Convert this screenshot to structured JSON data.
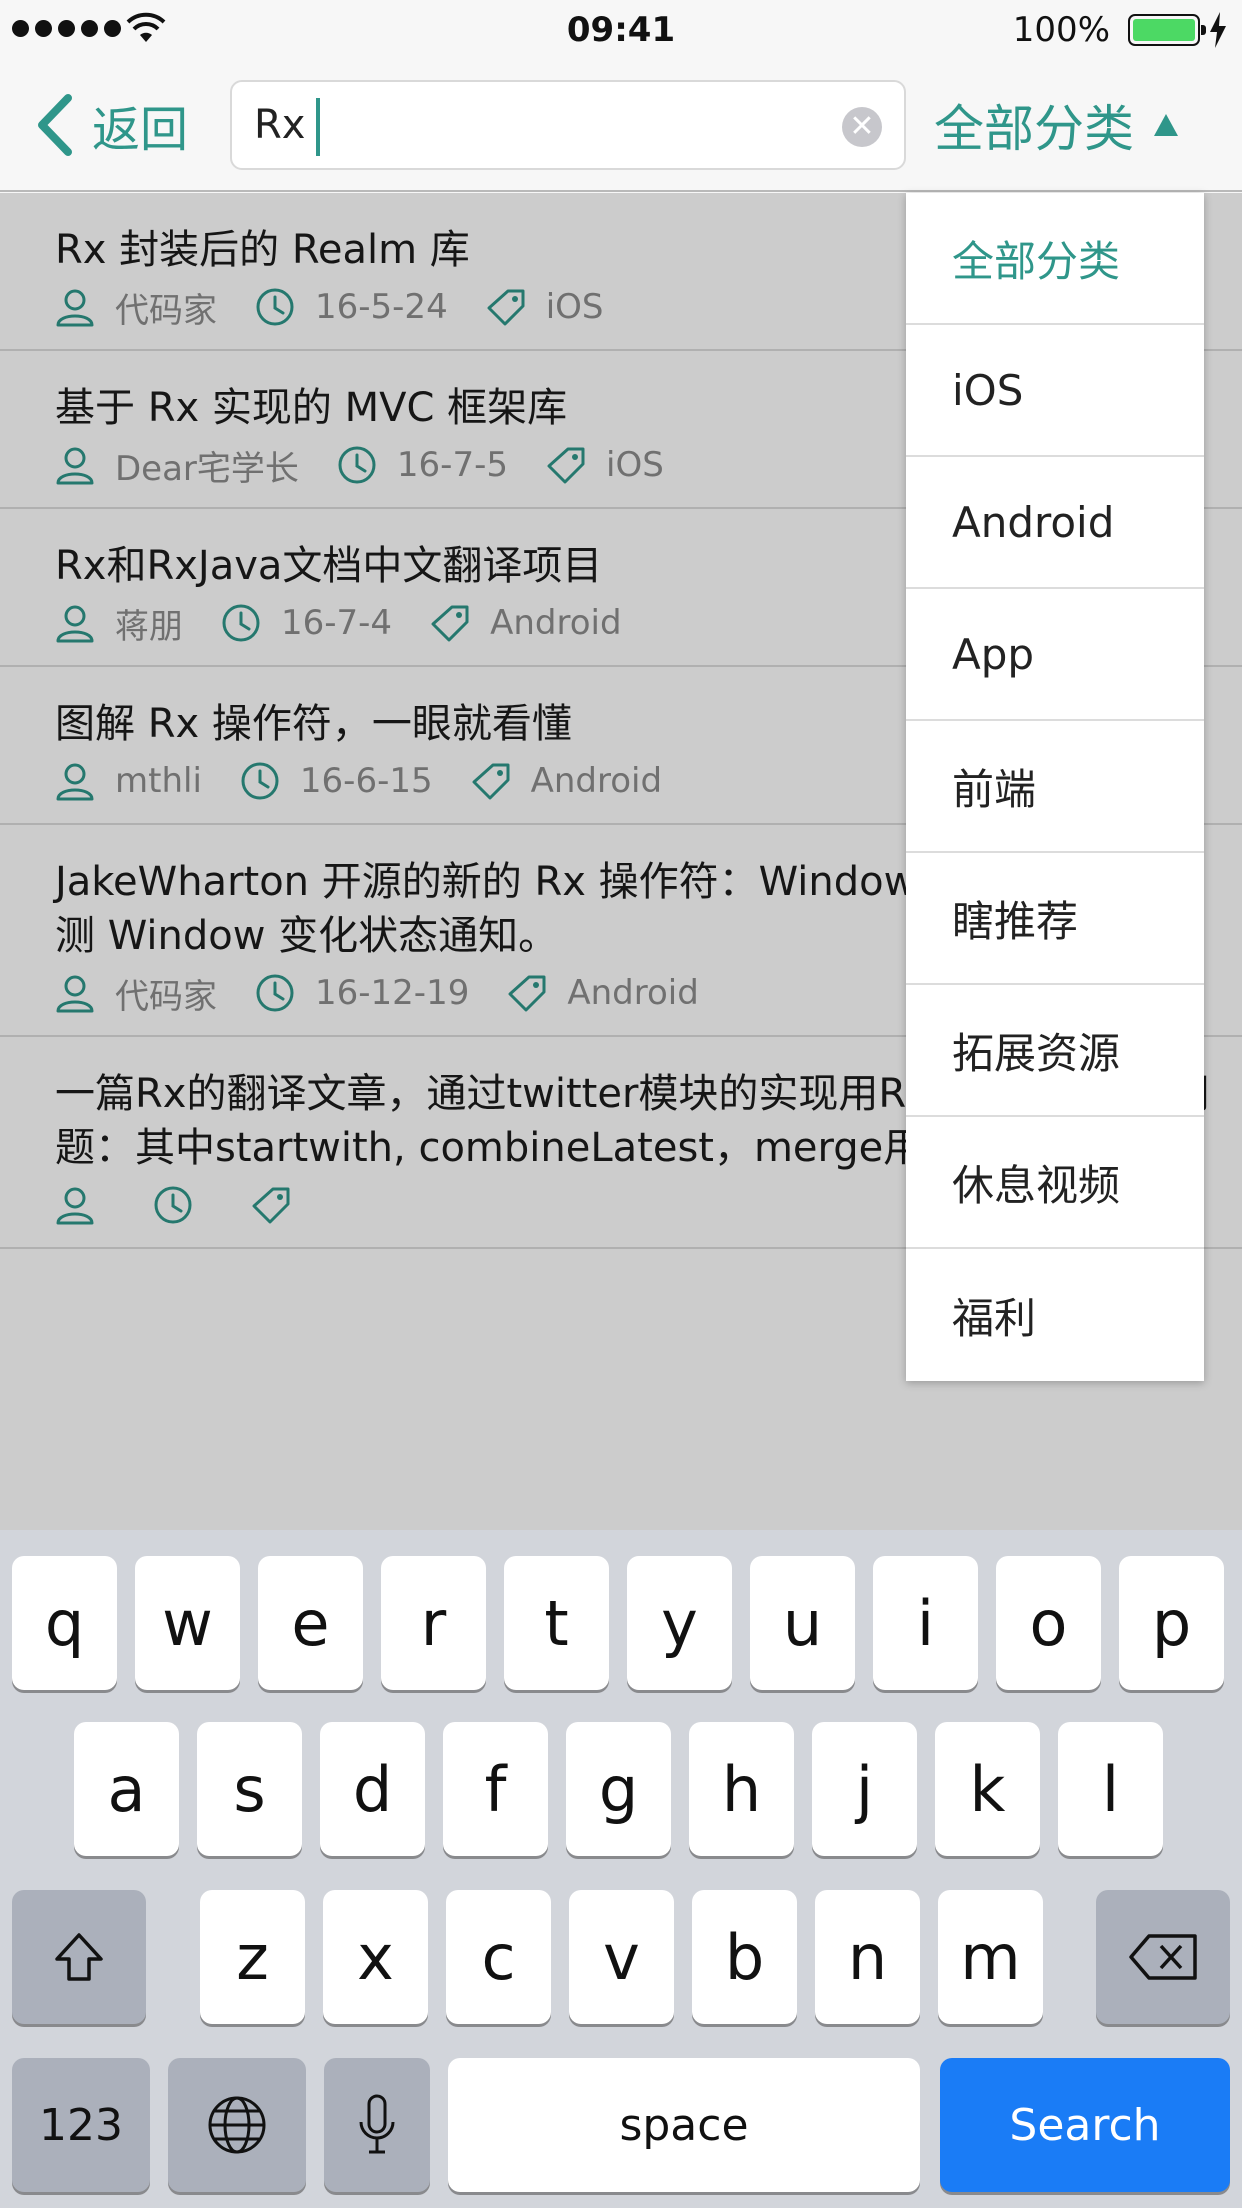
{
  "status_bar": {
    "time": "09:41",
    "battery_percent": "100%",
    "battery_level": 1.0,
    "battery_color": "#4cd964"
  },
  "nav": {
    "back_label": "返回",
    "search_value": "Rx",
    "category_label": "全部分类",
    "accent_color": "#2f968a"
  },
  "results": [
    {
      "title": "Rx 封装后的 Realm 库",
      "author": "代码家",
      "date": "16-5-24",
      "tag": "iOS"
    },
    {
      "title": "基于 Rx 实现的 MVC 框架库",
      "author": "Dear宅学长",
      "date": "16-7-5",
      "tag": "iOS"
    },
    {
      "title": "Rx和RxJava文档中文翻译项目",
      "author": "蒋朋",
      "date": "16-7-4",
      "tag": "Android"
    },
    {
      "title": "图解 Rx 操作符，一眼就看懂",
      "author": "mthli",
      "date": "16-6-15",
      "tag": "Android"
    },
    {
      "title": "JakeWharton 开源的新的 Rx 操作符：WindowIfChanged，检测 Window 变化状态通知。",
      "author": "代码家",
      "date": "16-12-19",
      "tag": "Android"
    },
    {
      "title": "一篇Rx的翻译文章，通过twitter模块的实现用Rx的思想来解决问题：其中startwith, combineLatest，merge用的很巧妙",
      "author": "",
      "date": "",
      "tag": ""
    }
  ],
  "dropdown": {
    "items": [
      "全部分类",
      "iOS",
      "Android",
      "App",
      "前端",
      "瞎推荐",
      "拓展资源",
      "休息视频",
      "福利"
    ],
    "selected": "全部分类"
  },
  "keyboard": {
    "row1": [
      "q",
      "w",
      "e",
      "r",
      "t",
      "y",
      "u",
      "i",
      "o",
      "p"
    ],
    "row2": [
      "a",
      "s",
      "d",
      "f",
      "g",
      "h",
      "j",
      "k",
      "l"
    ],
    "row3": [
      "z",
      "x",
      "c",
      "v",
      "b",
      "n",
      "m"
    ],
    "numbers_label": "123",
    "space_label": "space",
    "search_label": "Search"
  }
}
